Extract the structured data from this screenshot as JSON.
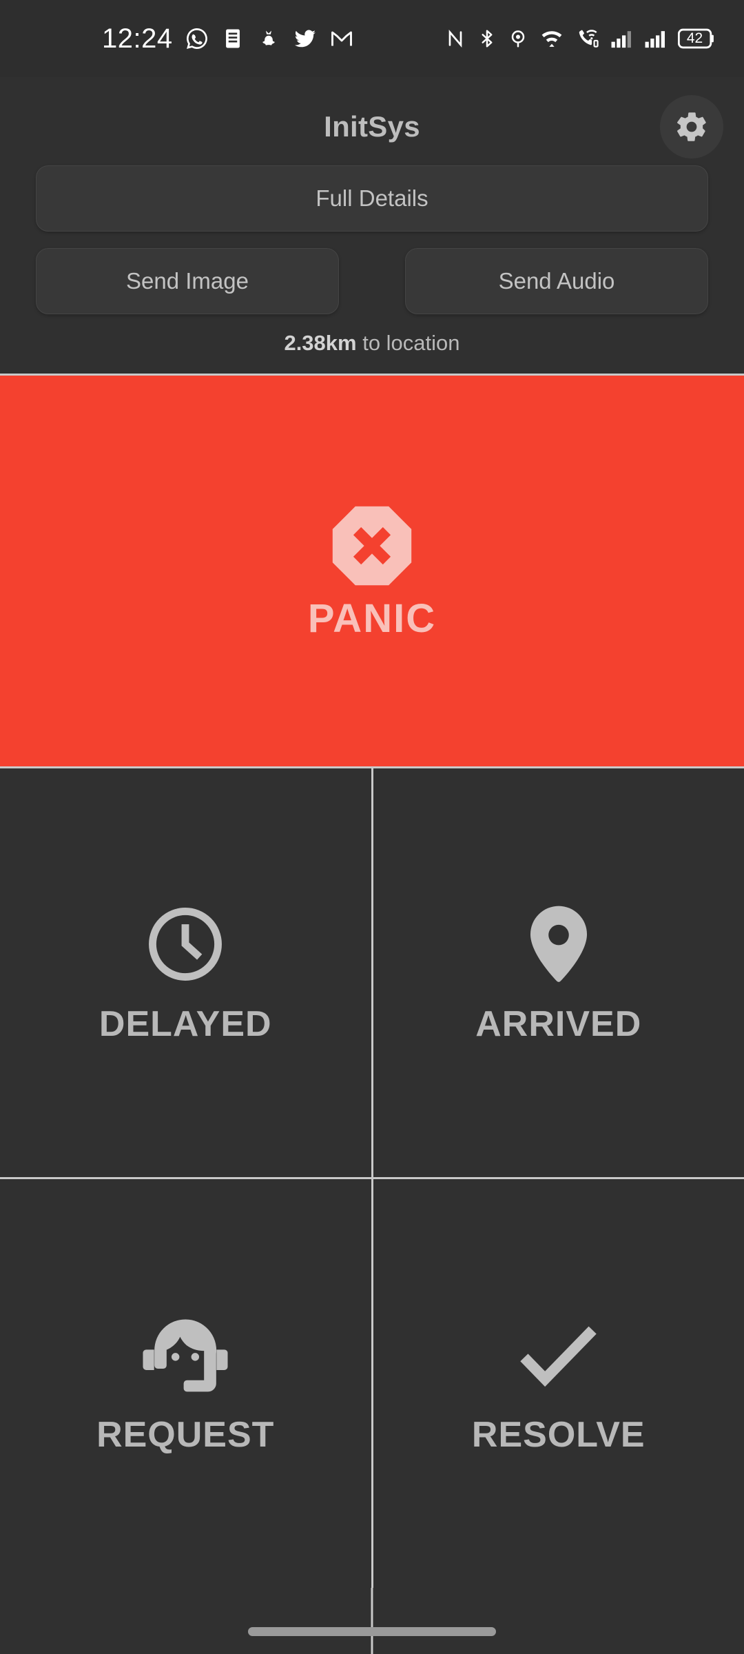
{
  "status_bar": {
    "time": "12:24",
    "left_icons": [
      "whatsapp-icon",
      "news-icon",
      "snapchat-icon",
      "twitter-icon",
      "gmail-icon"
    ],
    "right_icons": [
      "nfc-icon",
      "bluetooth-icon",
      "location-icon",
      "wifi-icon",
      "vowifi-call-icon",
      "signal-sim1-icon",
      "signal-sim2-icon"
    ],
    "battery_level": "42"
  },
  "header": {
    "title": "InitSys",
    "settings_icon": "gear-icon"
  },
  "actions": {
    "full_details_label": "Full Details",
    "send_image_label": "Send Image",
    "send_audio_label": "Send Audio"
  },
  "distance": {
    "value": "2.38km",
    "suffix": " to location"
  },
  "panic": {
    "label": "PANIC",
    "icon": "stop-octagon-x-icon",
    "background_color": "#f4412f",
    "foreground_color": "#f9c0b9"
  },
  "grid": {
    "tiles": [
      {
        "label": "DELAYED",
        "icon": "clock-icon"
      },
      {
        "label": "ARRIVED",
        "icon": "map-pin-icon"
      },
      {
        "label": "REQUEST",
        "icon": "support-headset-icon"
      },
      {
        "label": "RESOLVE",
        "icon": "checkmark-icon"
      }
    ]
  },
  "nav_bar": {
    "gesture_pill": "home-gesture-pill"
  },
  "theme": {
    "background": "#303030",
    "surface": "#383838",
    "divider": "#c9c9c9",
    "text_primary": "#bdbdbd",
    "accent_red": "#f4412f"
  }
}
